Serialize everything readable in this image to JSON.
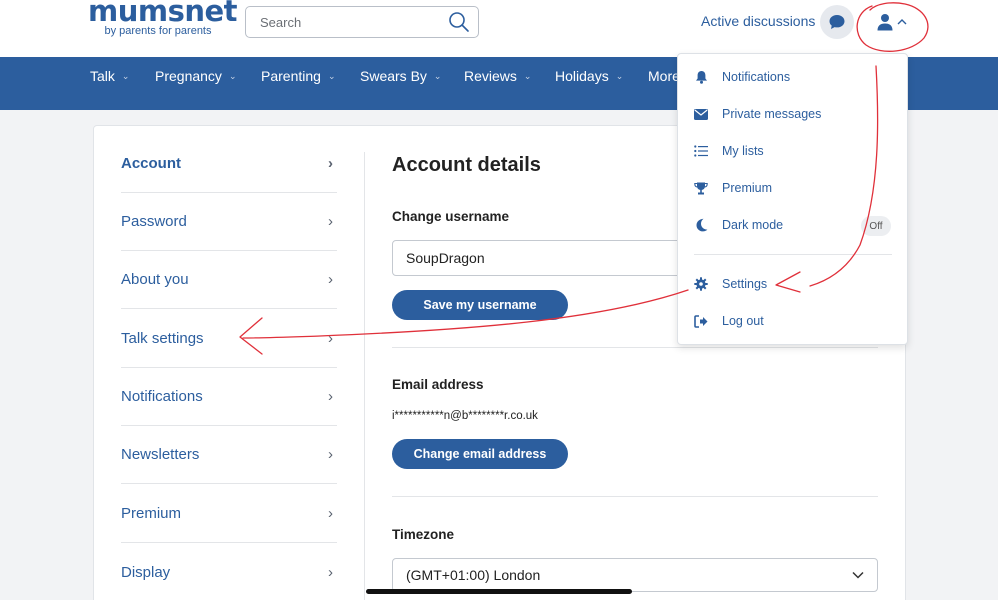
{
  "header": {
    "logo": "mumsnet",
    "tagline": "by parents for parents",
    "search_placeholder": "Search",
    "active_discussions": "Active discussions"
  },
  "nav": {
    "items": [
      "Talk",
      "Pregnancy",
      "Parenting",
      "Swears By",
      "Reviews",
      "Holidays",
      "More"
    ]
  },
  "sidebar": {
    "items": [
      "Account",
      "Password",
      "About you",
      "Talk settings",
      "Notifications",
      "Newsletters",
      "Premium",
      "Display"
    ],
    "active": "Account"
  },
  "main": {
    "title": "Account details",
    "change_username_label": "Change username",
    "username_value": "SoupDragon",
    "save_username_button": "Save my username",
    "email_label": "Email address",
    "email_value": "i***********n@b********r.co.uk",
    "change_email_button": "Change email address",
    "timezone_label": "Timezone",
    "timezone_value": "(GMT+01:00) London"
  },
  "user_menu": {
    "notifications": "Notifications",
    "private_messages": "Private messages",
    "my_lists": "My lists",
    "premium": "Premium",
    "dark_mode": "Dark mode",
    "dark_mode_state": "Off",
    "settings": "Settings",
    "log_out": "Log out"
  },
  "colors": {
    "brand": "#2c5e9e",
    "annotation": "#e0303a"
  }
}
